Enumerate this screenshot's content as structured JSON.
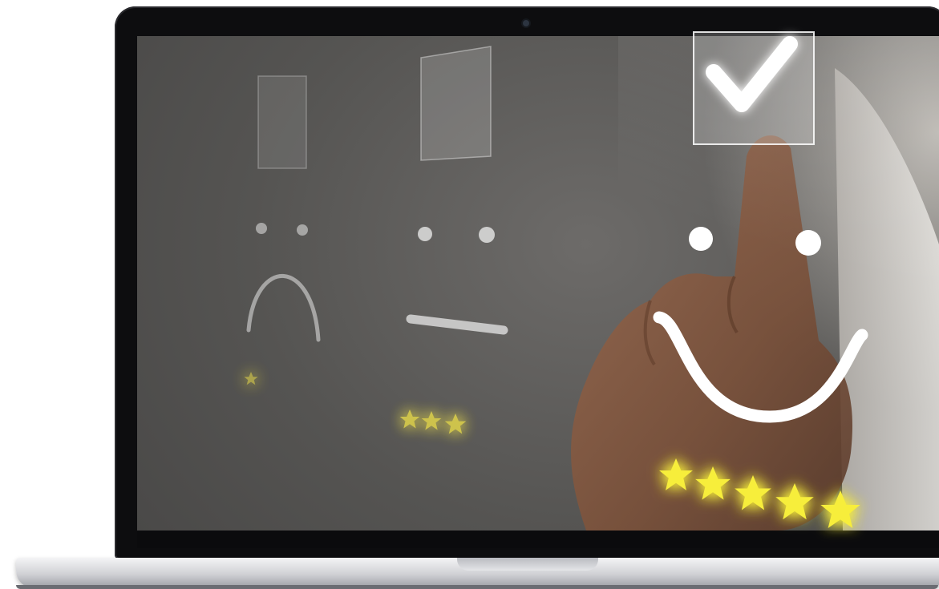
{
  "scene": {
    "device": "laptop",
    "colors": {
      "screen_bg": "#5b5a58",
      "face_stroke": "#ffffff",
      "star_fill": "#f4e64a",
      "skin": "#8a5e44"
    }
  },
  "rating_options": [
    {
      "mood": "sad",
      "stars": 1,
      "checked": false
    },
    {
      "mood": "neutral",
      "stars": 3,
      "checked": false
    },
    {
      "mood": "happy",
      "stars": 5,
      "checked": true
    }
  ]
}
